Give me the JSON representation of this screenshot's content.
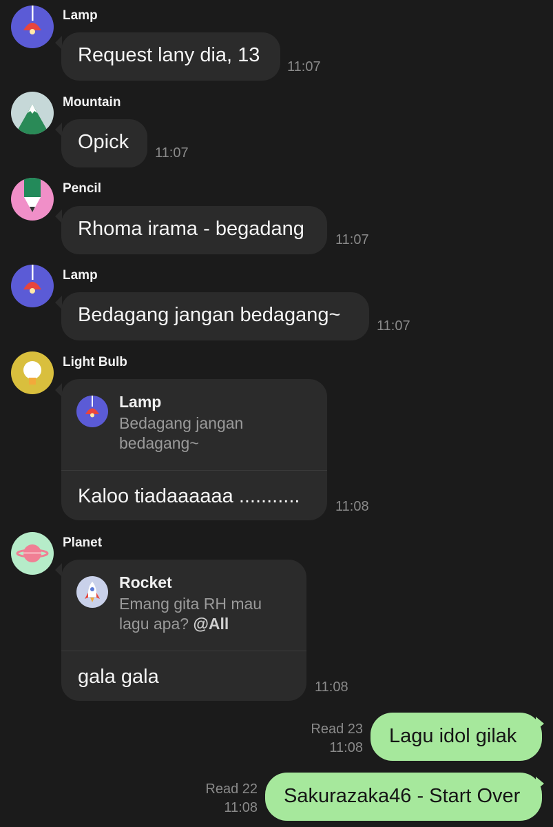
{
  "messages": [
    {
      "sender": "Lamp",
      "avatar_icon": "lamp-icon",
      "text": "Request lany dia, 13",
      "time": "11:07"
    },
    {
      "sender": "Mountain",
      "avatar_icon": "mountain-icon",
      "text": "Opick",
      "time": "11:07"
    },
    {
      "sender": "Pencil",
      "avatar_icon": "pencil-icon",
      "text": "Rhoma irama - begadang",
      "time": "11:07"
    },
    {
      "sender": "Lamp",
      "avatar_icon": "lamp-icon",
      "text": "Bedagang jangan bedagang~",
      "time": "11:07"
    },
    {
      "sender": "Light Bulb",
      "avatar_icon": "light-bulb-icon",
      "reply": {
        "name": "Lamp",
        "icon": "lamp-icon",
        "line1": "Bedagang jangan",
        "line2": "bedagang~"
      },
      "text": "Kaloo tiadaaaaaa ...........",
      "time": "11:08"
    },
    {
      "sender": "Planet",
      "avatar_icon": "planet-icon",
      "reply": {
        "name": "Rocket",
        "icon": "rocket-icon",
        "line1": "Emang gita RH mau",
        "line2": "lagu apa?",
        "mention": "@All"
      },
      "text": "gala gala",
      "time": "11:08"
    }
  ],
  "my_messages": [
    {
      "text": "Lagu idol gilak",
      "read": "Read 23",
      "time": "11:08"
    },
    {
      "text": "Sakurazaka46 - Start Over",
      "read": "Read 22",
      "time": "11:08"
    }
  ],
  "colors": {
    "background": "#1b1b1b",
    "incoming_bubble": "#2b2b2b",
    "outgoing_bubble": "#a6e89c",
    "timestamp": "#8a8a8a"
  }
}
